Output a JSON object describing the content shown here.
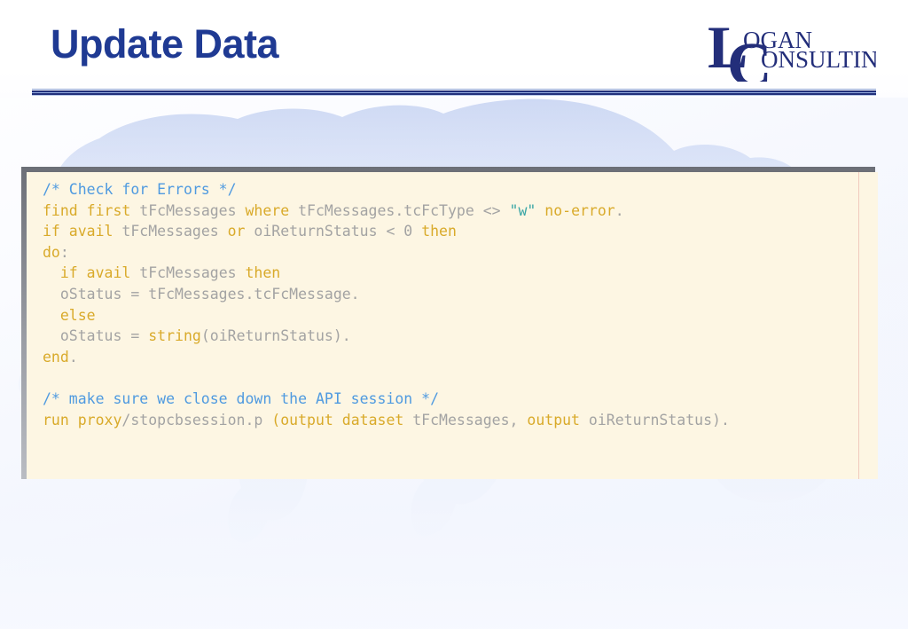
{
  "slide": {
    "title": "Update Data",
    "logo": {
      "name": "logan-consulting-logo",
      "line1_drop": "L",
      "line1_rest": "OGAN",
      "line2_drop": "C",
      "line2_rest": "ONSULTING",
      "full_text": "LOGAN CONSULTING"
    },
    "colors": {
      "title": "#1f3a93",
      "logo": "#232e7a",
      "rule": "#21307c",
      "code_bg": "#fdf6e3",
      "comment": "#4f9ae0",
      "keyword": "#d9aa2a",
      "identifier": "#a3a3a3",
      "string": "#3aa6a6",
      "margin_line": "#f0c9bd",
      "background": "#eef2fc"
    }
  },
  "code_block": {
    "language": "progress-abl",
    "lines": [
      [
        {
          "t": "com",
          "s": "/* Check for Errors */"
        }
      ],
      [
        {
          "t": "key",
          "s": "find first"
        },
        {
          "t": "id",
          "s": " tFcMessages "
        },
        {
          "t": "key",
          "s": "where"
        },
        {
          "t": "id",
          "s": " tFcMessages.tcFcType <> "
        },
        {
          "t": "str",
          "s": "\"w\""
        },
        {
          "t": "id",
          "s": " "
        },
        {
          "t": "key",
          "s": "no-error"
        },
        {
          "t": "pun",
          "s": "."
        }
      ],
      [
        {
          "t": "key",
          "s": "if avail"
        },
        {
          "t": "id",
          "s": " tFcMessages "
        },
        {
          "t": "key",
          "s": "or"
        },
        {
          "t": "id",
          "s": " oiReturnStatus < 0 "
        },
        {
          "t": "key",
          "s": "then"
        }
      ],
      [
        {
          "t": "key",
          "s": "do"
        },
        {
          "t": "pun",
          "s": ":"
        }
      ],
      [
        {
          "t": "id",
          "s": "  "
        },
        {
          "t": "key",
          "s": "if avail"
        },
        {
          "t": "id",
          "s": " tFcMessages "
        },
        {
          "t": "key",
          "s": "then"
        }
      ],
      [
        {
          "t": "id",
          "s": "  oStatus = tFcMessages.tcFcMessage."
        }
      ],
      [
        {
          "t": "id",
          "s": "  "
        },
        {
          "t": "key",
          "s": "else"
        }
      ],
      [
        {
          "t": "id",
          "s": "  oStatus = "
        },
        {
          "t": "key",
          "s": "string"
        },
        {
          "t": "id",
          "s": "(oiReturnStatus)."
        }
      ],
      [
        {
          "t": "key",
          "s": "end"
        },
        {
          "t": "pun",
          "s": "."
        }
      ],
      [
        {
          "t": "id",
          "s": ""
        }
      ],
      [
        {
          "t": "com",
          "s": "/* make sure we close down the API session */"
        }
      ],
      [
        {
          "t": "key",
          "s": "run proxy"
        },
        {
          "t": "id",
          "s": "/stopcbsession.p "
        },
        {
          "t": "key",
          "s": "("
        },
        {
          "t": "key",
          "s": "output dataset"
        },
        {
          "t": "id",
          "s": " tFcMessages, "
        },
        {
          "t": "key",
          "s": "output"
        },
        {
          "t": "id",
          "s": " oiReturnStatus)."
        }
      ]
    ],
    "plain_text": "/* Check for Errors */\nfind first tFcMessages where tFcMessages.tcFcType <> \"w\" no-error.\nif avail tFcMessages or oiReturnStatus < 0 then\ndo:\n  if avail tFcMessages then\n  oStatus = tFcMessages.tcFcMessage.\n  else\n  oStatus = string(oiReturnStatus).\nend.\n\n/* make sure we close down the API session */\nrun proxy/stopcbsession.p (output dataset tFcMessages, output oiReturnStatus)."
  }
}
